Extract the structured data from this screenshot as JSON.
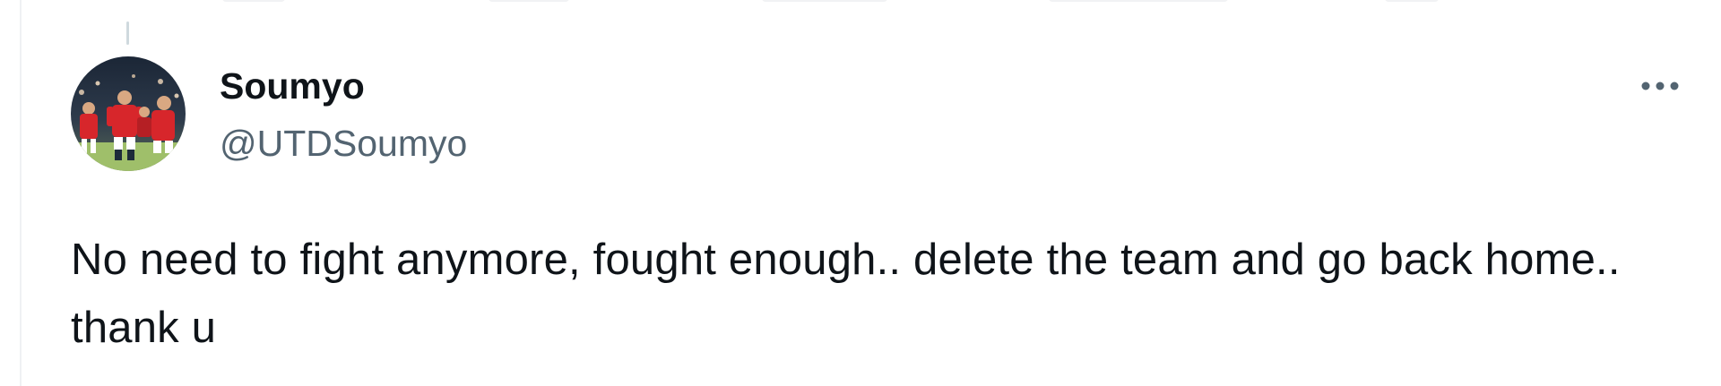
{
  "tweet": {
    "display_name": "Soumyo",
    "handle": "@UTDSoumyo",
    "text": "No need to fight anymore, fought enough.. delete the team and go back home.. thank u",
    "more_icon": "more-horizontal-icon"
  },
  "colors": {
    "text_primary": "#0f1419",
    "text_secondary": "#536471",
    "thread_line": "#cfd9de",
    "border": "#eff1f3",
    "avatar_red": "#d7262b",
    "avatar_dark": "#1d2b3a",
    "avatar_grass": "#9fbf6a"
  }
}
